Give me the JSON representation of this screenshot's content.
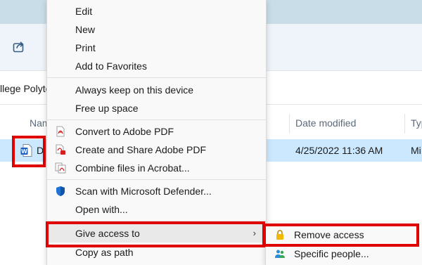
{
  "explorer": {
    "address_fragment": "llege Polyte",
    "columns": {
      "name": "Nam",
      "date_modified": "Date modified",
      "type": "Typ"
    },
    "file": {
      "name_fragment": "D",
      "date_modified": "4/25/2022 11:36 AM",
      "type_fragment": "Mi"
    }
  },
  "context_menu": {
    "items": [
      {
        "label": "Edit"
      },
      {
        "label": "New"
      },
      {
        "label": "Print"
      },
      {
        "label": "Add to Favorites"
      },
      {
        "label": "Always keep on this device"
      },
      {
        "label": "Free up space"
      },
      {
        "label": "Convert to Adobe PDF",
        "icon": "adobe-pdf-icon"
      },
      {
        "label": "Create and Share Adobe PDF",
        "icon": "adobe-pdf-share-icon"
      },
      {
        "label": "Combine files in Acrobat...",
        "icon": "acrobat-combine-icon"
      },
      {
        "label": "Scan with Microsoft Defender...",
        "icon": "defender-shield-icon"
      },
      {
        "label": "Open with..."
      },
      {
        "label": "Give access to",
        "has_submenu": true
      },
      {
        "label": "Copy as path"
      }
    ],
    "submenu_chevron": "›"
  },
  "give_access_submenu": {
    "items": [
      {
        "label": "Remove access",
        "icon": "lock-icon"
      },
      {
        "label": "Specific people...",
        "icon": "people-icon"
      }
    ]
  },
  "colors": {
    "highlight_red": "#e00000",
    "selected_row": "#cce8ff",
    "menu_bg": "#f9f9f9"
  }
}
